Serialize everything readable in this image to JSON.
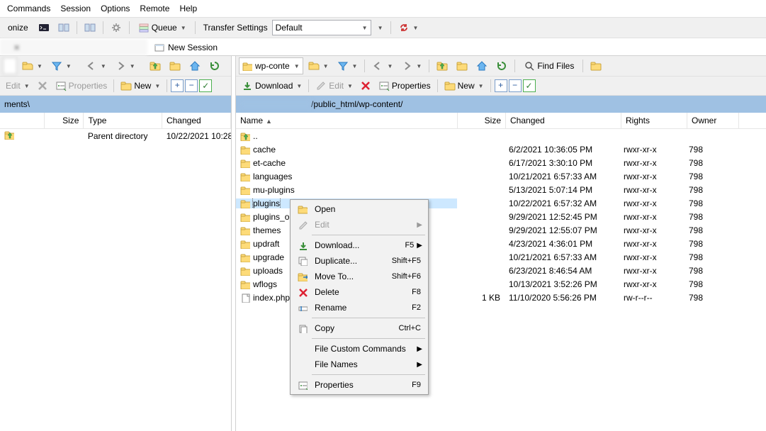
{
  "menu": [
    "Commands",
    "Session",
    "Options",
    "Remote",
    "Help"
  ],
  "toolbar1": {
    "sync_label": "onize",
    "queue_label": "Queue",
    "transfer_label": "Transfer Settings",
    "transfer_value": "Default"
  },
  "tabs": {
    "session_placeholder": " ",
    "new_session": "New Session"
  },
  "left": {
    "drive_label": " ",
    "actions": {
      "edit": "Edit",
      "properties": "Properties",
      "new": "New"
    },
    "path": "ments\\",
    "columns": {
      "name": "",
      "size": "Size",
      "type": "Type",
      "changed": "Changed"
    },
    "rows": [
      {
        "name": "",
        "size": "",
        "type": "Parent directory",
        "changed": "10/22/2021 10:28"
      }
    ]
  },
  "right": {
    "drive_label": "wp-conte",
    "find_files": "Find Files",
    "actions": {
      "download": "Download",
      "edit": "Edit",
      "properties": "Properties",
      "new": "New"
    },
    "path_visible": "/public_html/wp-content/",
    "columns": {
      "name": "Name",
      "size": "Size",
      "changed": "Changed",
      "rights": "Rights",
      "owner": "Owner"
    },
    "rows": [
      {
        "icon": "up",
        "name": "..",
        "size": "",
        "changed": "",
        "rights": "",
        "owner": ""
      },
      {
        "icon": "folder",
        "name": "cache",
        "size": "",
        "changed": "6/2/2021 10:36:05 PM",
        "rights": "rwxr-xr-x",
        "owner": "798"
      },
      {
        "icon": "folder",
        "name": "et-cache",
        "size": "",
        "changed": "6/17/2021 3:30:10 PM",
        "rights": "rwxr-xr-x",
        "owner": "798"
      },
      {
        "icon": "folder",
        "name": "languages",
        "size": "",
        "changed": "10/21/2021 6:57:33 AM",
        "rights": "rwxr-xr-x",
        "owner": "798"
      },
      {
        "icon": "folder",
        "name": "mu-plugins",
        "size": "",
        "changed": "5/13/2021 5:07:14 PM",
        "rights": "rwxr-xr-x",
        "owner": "798"
      },
      {
        "icon": "folder",
        "name": "plugins",
        "size": "",
        "changed": "10/22/2021 6:57:32 AM",
        "rights": "rwxr-xr-x",
        "owner": "798",
        "selected": true
      },
      {
        "icon": "folder",
        "name": "plugins_old",
        "size": "",
        "changed": "9/29/2021 12:52:45 PM",
        "rights": "rwxr-xr-x",
        "owner": "798"
      },
      {
        "icon": "folder",
        "name": "themes",
        "size": "",
        "changed": "9/29/2021 12:55:07 PM",
        "rights": "rwxr-xr-x",
        "owner": "798"
      },
      {
        "icon": "folder",
        "name": "updraft",
        "size": "",
        "changed": "4/23/2021 4:36:01 PM",
        "rights": "rwxr-xr-x",
        "owner": "798"
      },
      {
        "icon": "folder",
        "name": "upgrade",
        "size": "",
        "changed": "10/21/2021 6:57:33 AM",
        "rights": "rwxr-xr-x",
        "owner": "798"
      },
      {
        "icon": "folder",
        "name": "uploads",
        "size": "",
        "changed": "6/23/2021 8:46:54 AM",
        "rights": "rwxr-xr-x",
        "owner": "798"
      },
      {
        "icon": "folder",
        "name": "wflogs",
        "size": "",
        "changed": "10/13/2021 3:52:26 PM",
        "rights": "rwxr-xr-x",
        "owner": "798"
      },
      {
        "icon": "file",
        "name": "index.php",
        "size": "1 KB",
        "changed": "11/10/2020 5:56:26 PM",
        "rights": "rw-r--r--",
        "owner": "798"
      }
    ]
  },
  "context_menu": [
    {
      "icon": "open",
      "label": "Open",
      "shortcut": "",
      "type": "item"
    },
    {
      "icon": "edit",
      "label": "Edit",
      "shortcut": "",
      "type": "item",
      "disabled": true,
      "submenu": true
    },
    {
      "type": "sep"
    },
    {
      "icon": "download",
      "label": "Download...",
      "shortcut": "F5",
      "type": "item",
      "submenu": true
    },
    {
      "icon": "duplicate",
      "label": "Duplicate...",
      "shortcut": "Shift+F5",
      "type": "item"
    },
    {
      "icon": "moveto",
      "label": "Move To...",
      "shortcut": "Shift+F6",
      "type": "item"
    },
    {
      "icon": "delete",
      "label": "Delete",
      "shortcut": "F8",
      "type": "item"
    },
    {
      "icon": "rename",
      "label": "Rename",
      "shortcut": "F2",
      "type": "item"
    },
    {
      "type": "sep"
    },
    {
      "icon": "copy",
      "label": "Copy",
      "shortcut": "Ctrl+C",
      "type": "item"
    },
    {
      "type": "sep"
    },
    {
      "icon": "",
      "label": "File Custom Commands",
      "shortcut": "",
      "type": "item",
      "submenu": true
    },
    {
      "icon": "",
      "label": "File Names",
      "shortcut": "",
      "type": "item",
      "submenu": true
    },
    {
      "type": "sep"
    },
    {
      "icon": "properties",
      "label": "Properties",
      "shortcut": "F9",
      "type": "item"
    }
  ]
}
